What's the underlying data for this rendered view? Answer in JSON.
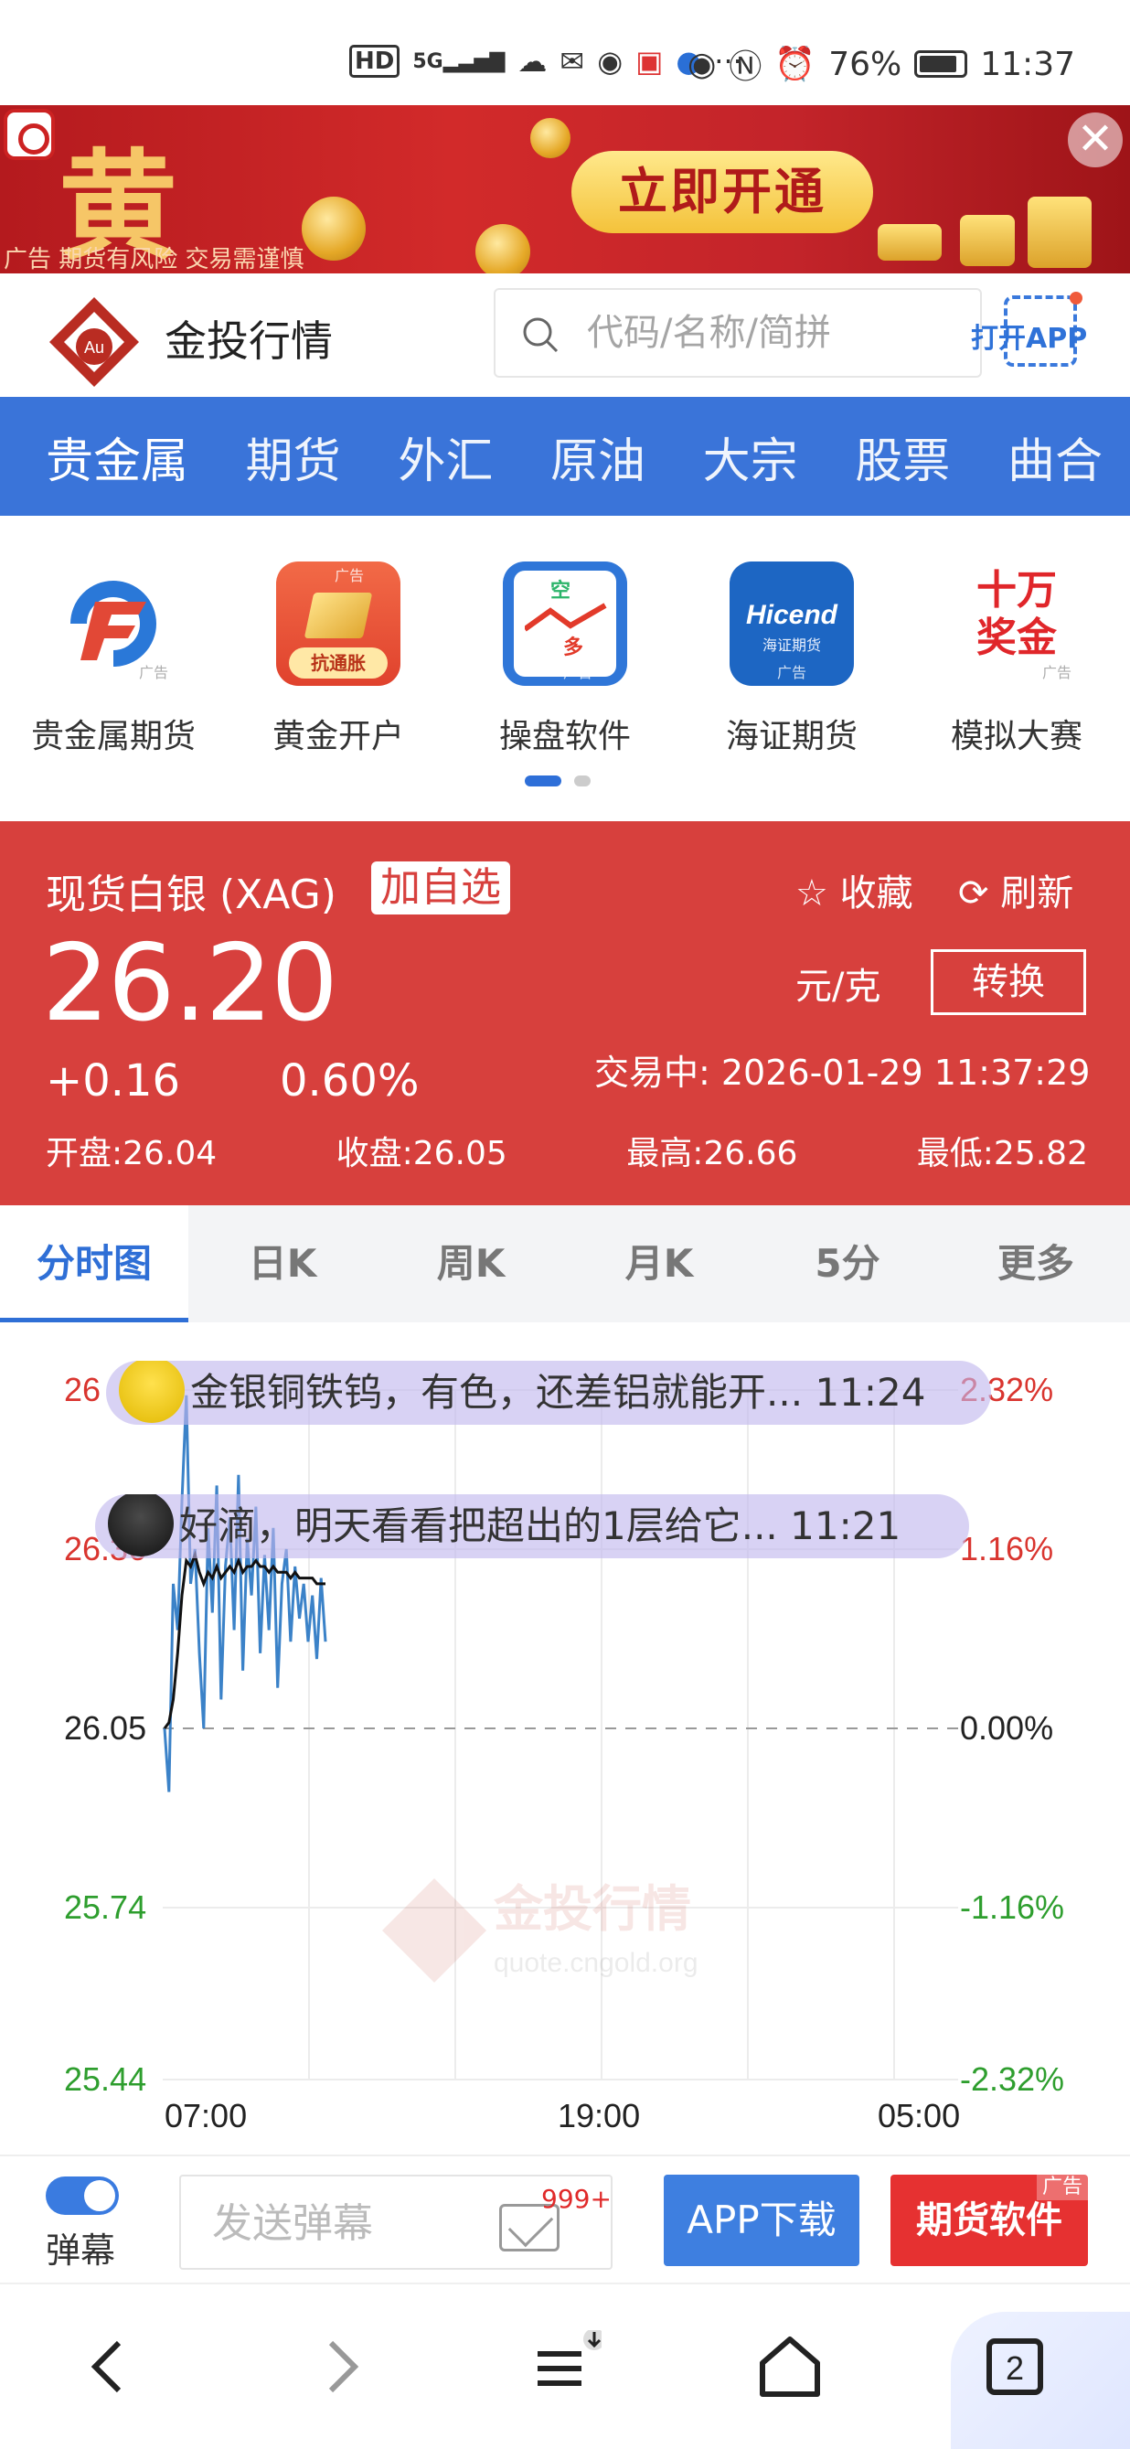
{
  "status_bar": {
    "icons": [
      "hd-icon",
      "5g-signal-icon",
      "nfc-icon",
      "eye-icon",
      "alarm-icon"
    ],
    "battery": "76%",
    "time": "11:37"
  },
  "ad_banner": {
    "big_char": "黄",
    "cta": "立即开通",
    "disclaimer": "广告 期货有风险 交易需谨慎",
    "close": "✕"
  },
  "header": {
    "brand_mark": "Au",
    "title": "金投行情",
    "search_placeholder": "代码/名称/简拼",
    "open_app": "打开APP"
  },
  "nav": {
    "tabs": [
      {
        "label": "贵金属"
      },
      {
        "label": "期货"
      },
      {
        "label": "外汇"
      },
      {
        "label": "原油"
      },
      {
        "label": "大宗"
      },
      {
        "label": "股票"
      },
      {
        "label": "曲合"
      }
    ]
  },
  "shortcuts": [
    {
      "label": "贵金属期货",
      "tag": "广告"
    },
    {
      "label": "黄金开户",
      "tag": "广告",
      "badge": "抗通胀"
    },
    {
      "label": "操盘软件",
      "tag": "广告",
      "icon_top": "空",
      "icon_bottom": "多"
    },
    {
      "label": "海证期货",
      "tag": "广告",
      "brand": "Hicend",
      "sub": "海证期货"
    },
    {
      "label": "模拟大赛",
      "tag": "广告",
      "art": "十万奖金"
    }
  ],
  "quote": {
    "name": "现货白银 (XAG)",
    "add_watch": "加自选",
    "collect": "收藏",
    "refresh": "刷新",
    "price": "26.20",
    "unit": "元/克",
    "convert": "转换",
    "change": "+0.16",
    "change_pct": "0.60%",
    "status": "交易中:  2026-01-29 11:37:29",
    "open": "开盘:26.04",
    "close": "收盘:26.05",
    "high": "最高:26.66",
    "low": "最低:25.82"
  },
  "kline_tabs": [
    {
      "label": "分时图"
    },
    {
      "label": "日K"
    },
    {
      "label": "周K"
    },
    {
      "label": "月K"
    },
    {
      "label": "5分"
    },
    {
      "label": "更多"
    }
  ],
  "chart": {
    "watermark": "金投行情",
    "watermark_url": "quote.cngold.org",
    "colors": {
      "up": "#d9352f",
      "down": "#2e9e2e",
      "flat": "#222",
      "line": "#3b82c8",
      "avg": "#111"
    }
  },
  "chart_data": {
    "type": "line",
    "y_left_ticks": [
      "26",
      "26.36",
      "26.05",
      "25.74",
      "25.44"
    ],
    "y_right_ticks": [
      "2.32%",
      "1.16%",
      "0.00%",
      "-1.16%",
      "-2.32%"
    ],
    "x_ticks": [
      "07:00",
      "19:00",
      "05:00"
    ],
    "ylim": [
      25.44,
      26.66
    ],
    "baseline": 26.05,
    "series": [
      {
        "values": [
          26.05,
          25.94,
          26.3,
          26.22,
          26.45,
          26.65,
          26.3,
          26.36,
          26.18,
          26.05,
          26.4,
          26.25,
          26.48,
          26.1,
          26.33,
          26.42,
          26.22,
          26.5,
          26.15,
          26.38,
          26.28,
          26.44,
          26.18,
          26.35,
          26.22,
          26.4,
          26.12,
          26.3,
          26.36,
          26.2,
          26.33,
          26.24,
          26.3,
          26.2,
          26.28,
          26.17,
          26.31,
          26.2
        ]
      },
      {
        "values": [
          26.05,
          26.06,
          26.1,
          26.18,
          26.28,
          26.34,
          26.33,
          26.35,
          26.32,
          26.3,
          26.32,
          26.31,
          26.33,
          26.31,
          26.32,
          26.33,
          26.32,
          26.34,
          26.32,
          26.33,
          26.33,
          26.34,
          26.33,
          26.33,
          26.32,
          26.33,
          26.32,
          26.32,
          26.32,
          26.31,
          26.32,
          26.31,
          26.31,
          26.31,
          26.31,
          26.3,
          26.3,
          26.3
        ]
      }
    ]
  },
  "danmu": [
    {
      "text": "金银铜铁钨，有色，还差铝就能开... 11:24"
    },
    {
      "text": "好滴，明天看看把超出的1层给它... 11:21"
    }
  ],
  "bottom_bar": {
    "toggle_label": "弹幕",
    "input_placeholder": "发送弹幕",
    "message_count": "999+",
    "app_download": "APP下载",
    "futures_software": "期货软件",
    "ad_tag": "广告"
  },
  "system_nav": {
    "tab_count": "2"
  }
}
